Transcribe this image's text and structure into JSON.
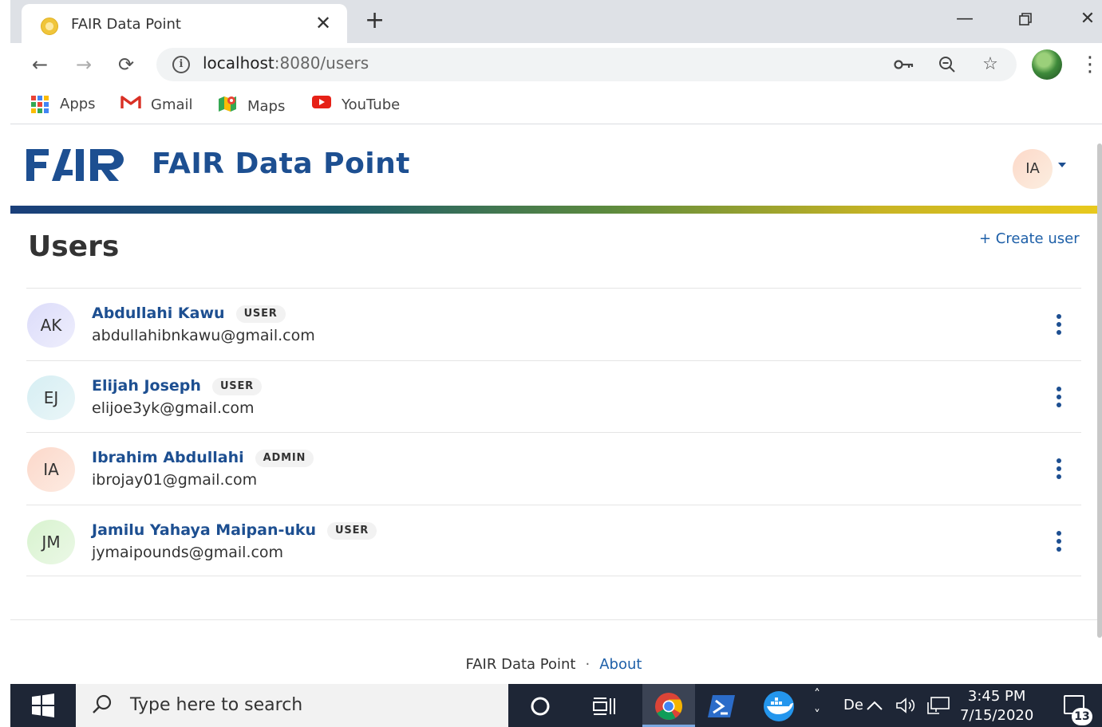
{
  "browser": {
    "tab_title": "FAIR Data Point",
    "url_host": "localhost",
    "url_rest": ":8080/users",
    "bookmarks": [
      {
        "label": "Apps"
      },
      {
        "label": "Gmail"
      },
      {
        "label": "Maps"
      },
      {
        "label": "YouTube"
      }
    ]
  },
  "header": {
    "brand": "FAIR Data Point",
    "logo_text": "FAIR",
    "user_initials": "IA"
  },
  "main": {
    "title": "Users",
    "create_label": "+ Create user",
    "users": [
      {
        "initials": "AK",
        "name": "Abdullahi Kawu",
        "role": "USER",
        "email": "abdullahibnkawu@gmail.com",
        "avatar_color": "#e4e3fb"
      },
      {
        "initials": "EJ",
        "name": "Elijah Joseph",
        "role": "USER",
        "email": "elijoe3yk@gmail.com",
        "avatar_color": "#dff2f6"
      },
      {
        "initials": "IA",
        "name": "Ibrahim Abdullahi",
        "role": "ADMIN",
        "email": "ibrojay01@gmail.com",
        "avatar_color": "#fde3d8"
      },
      {
        "initials": "JM",
        "name": "Jamilu Yahaya Maipan-uku",
        "role": "USER",
        "email": "jymaipounds@gmail.com",
        "avatar_color": "#e2f6dc"
      }
    ]
  },
  "footer": {
    "brand": "FAIR Data Point",
    "separator": "·",
    "about": "About"
  },
  "taskbar": {
    "search_placeholder": "Type here to search",
    "tray_text": "Dе",
    "time": "3:45 PM",
    "date": "7/15/2020",
    "notification_count": "13"
  },
  "colors": {
    "brand_blue": "#1d4f91",
    "link_blue": "#1d5fa8"
  }
}
